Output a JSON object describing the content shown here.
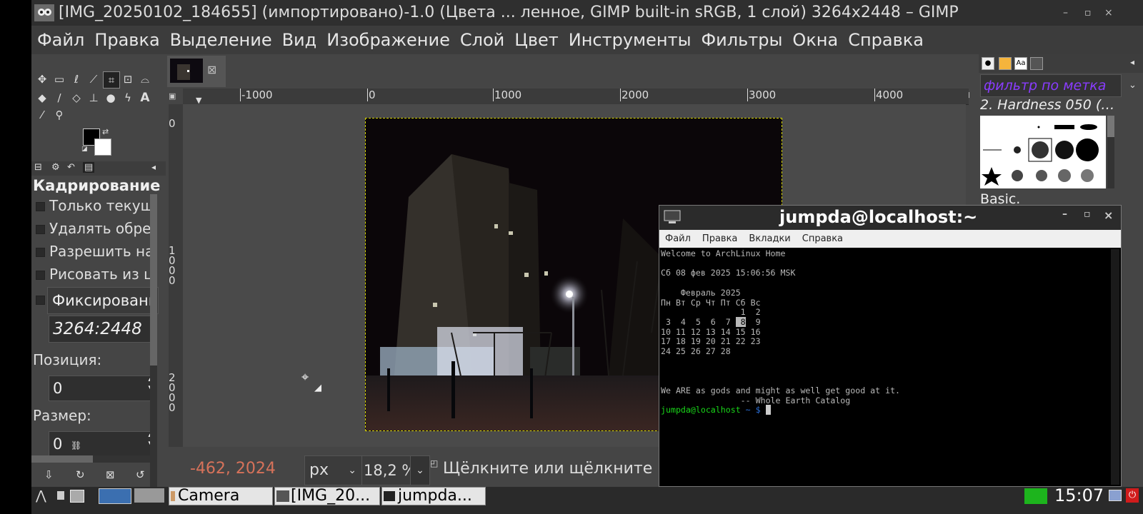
{
  "window": {
    "title": "[IMG_20250102_184655] (импортировано)-1.0 (Цвета ... ленное, GIMP built-in sRGB, 1 слой) 3264x2448 – GIMP",
    "min": "–",
    "max": "▫",
    "close": "×"
  },
  "menu": [
    "Файл",
    "Правка",
    "Выделение",
    "Вид",
    "Изображение",
    "Слой",
    "Цвет",
    "Инструменты",
    "Фильтры",
    "Окна",
    "Справка"
  ],
  "tool_options": {
    "title": "Кадрирование",
    "options": [
      "Только текущи",
      "Удалять обрез",
      "Разрешить нар",
      "Рисовать из це"
    ],
    "fixed_label": "Фиксированн",
    "ratio": "3264:2448",
    "position_label": "Позиция:",
    "position_value": "0",
    "size_label": "Размер:",
    "size_value": "0"
  },
  "ruler": {
    "h_labels": [
      "-1000",
      "0",
      "1000",
      "2000",
      "3000",
      "4000"
    ],
    "v_label_0": "0",
    "v_label_1000": "1000",
    "v_label_2000": "2000"
  },
  "status": {
    "coords": "-462, 2024",
    "unit": "px",
    "zoom": "18,2 %",
    "hint": "Щёлкните или щёлкните и"
  },
  "right_dock": {
    "filter_placeholder": "фильтр по метка",
    "brush_name": "2. Hardness 050 (…",
    "preset": "Basic."
  },
  "terminal": {
    "title": "jumpda@localhost:~",
    "menu": [
      "Файл",
      "Правка",
      "Вкладки",
      "Справка"
    ],
    "welcome": "Welcome to ArchLinux Home",
    "date": "Сб 08 фев 2025 15:06:56 MSK",
    "cal_header": "    Февраль 2025",
    "cal_days": "Пн Вт Ср Чт Пт Сб Вс",
    "cal_w1": "                1  2",
    "cal_w2_pre": " 3  4  5  6  7 ",
    "cal_today": " 8",
    "cal_w2_post": "  9",
    "cal_w3": "10 11 12 13 14 15 16",
    "cal_w4": "17 18 19 20 21 22 23",
    "cal_w5": "24 25 26 27 28",
    "quote": "We ARE as gods and might as well get good at it.",
    "quote_author": "                -- Whole Earth Catalog",
    "prompt_user": "jumpda@localhost",
    "prompt_rest": " ~ $ "
  },
  "taskbar": {
    "tasks": [
      "Camera",
      "[IMG_20...",
      "jumpda..."
    ],
    "clock": "15:07"
  },
  "colors": {
    "accent_green": "#1db41d",
    "prompt_green": "#19d619",
    "selection_yellow": "#d6d600",
    "filter_purple": "#8a3cff",
    "power_red": "#d01c1c"
  }
}
